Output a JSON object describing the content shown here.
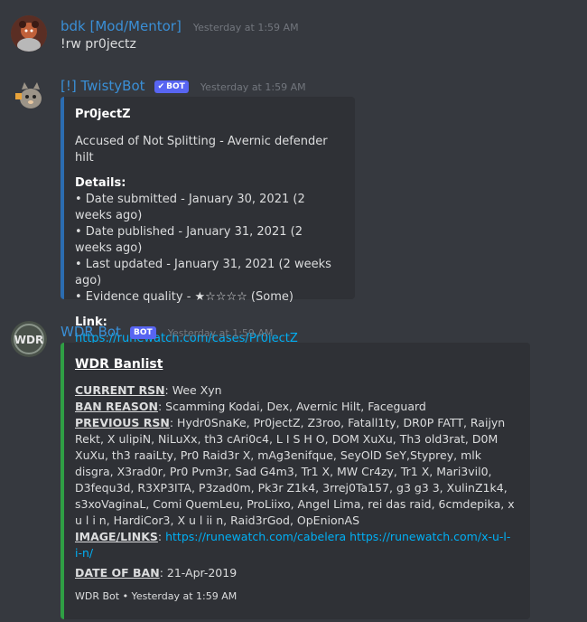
{
  "messages": [
    {
      "author": "bdk [Mod/Mentor]",
      "author_color": "#3a8fd6",
      "timestamp": "Yesterday at 1:59 AM",
      "text": "!rw pr0jectz"
    },
    {
      "author": "[!] TwistyBot",
      "author_color": "#3a8fd6",
      "bot_tag": "BOT",
      "bot_verified": "✔",
      "timestamp": "Yesterday at 1:59 AM",
      "embed": {
        "title": "Pr0jectZ",
        "description": "Accused of Not Splitting - Avernic defender hilt",
        "details_heading": "Details:",
        "details": [
          "• Date submitted - January 30, 2021 (2 weeks ago)",
          "• Date published - January 31, 2021 (2 weeks ago)",
          "• Last updated - January 31, 2021 (2 weeks ago)",
          "• Evidence quality - ★☆☆☆☆ (Some)"
        ],
        "link_heading": "Link:",
        "link": "https://runewatch.com/cases/Pr0jectZ"
      }
    },
    {
      "author": "WDR Bot",
      "author_color": "#3a8fd6",
      "bot_tag": "BOT",
      "timestamp": "Yesterday at 1:59 AM",
      "avatar_text": "WDR",
      "embed": {
        "title": "WDR Banlist",
        "current_rsn_label": "CURRENT RSN",
        "current_rsn": ": Wee Xyn",
        "ban_reason_label": "BAN REASON",
        "ban_reason": ": Scamming Kodai, Dex, Avernic Hilt, Faceguard",
        "previous_rsn_label": "PREVIOUS RSN",
        "previous_rsn": ": Hydr0SnaKe, Pr0jectZ, Z3roo, Fatall1ty, DR0P FATT, Raijyn Rekt, X ulipiN, NiLuXx, th3 cAri0c4, L I S H O, DOM XuXu, Th3 old3rat, D0M XuXu, th3 raaiLty, Pr0 Raid3r X, mAg3enifque, SeyOlD SeY,Styprey, mlk disgra, X3rad0r, Pr0 Pvm3r, Sad G4m3, Tr1 X, MW Cr4zy, Tr1 X, Mari3vil0, D3fequ3d, R3XP3ITA, P3zad0m, Pk3r Z1k4, 3rrej0Ta157, g3 g3 3, XulinZ1k4, s3xoVaginaL, Comi QuemLeu, ProLiixo, Angel Lima, rei das raid, 6cmdepika, x u l i n, HardiCor3, X u l ii n, Raid3rGod, OpEnionAS",
        "image_links_label": "IMAGE/LINKS",
        "image_links_sep": ": ",
        "image_links": "https://runewatch.com/cabelera https://runewatch.com/x-u-l-i-n/",
        "date_of_ban_label": "DATE OF BAN",
        "date_of_ban": ": 21-Apr-2019",
        "footer": "WDR Bot • Yesterday at 1:59 AM"
      }
    }
  ]
}
